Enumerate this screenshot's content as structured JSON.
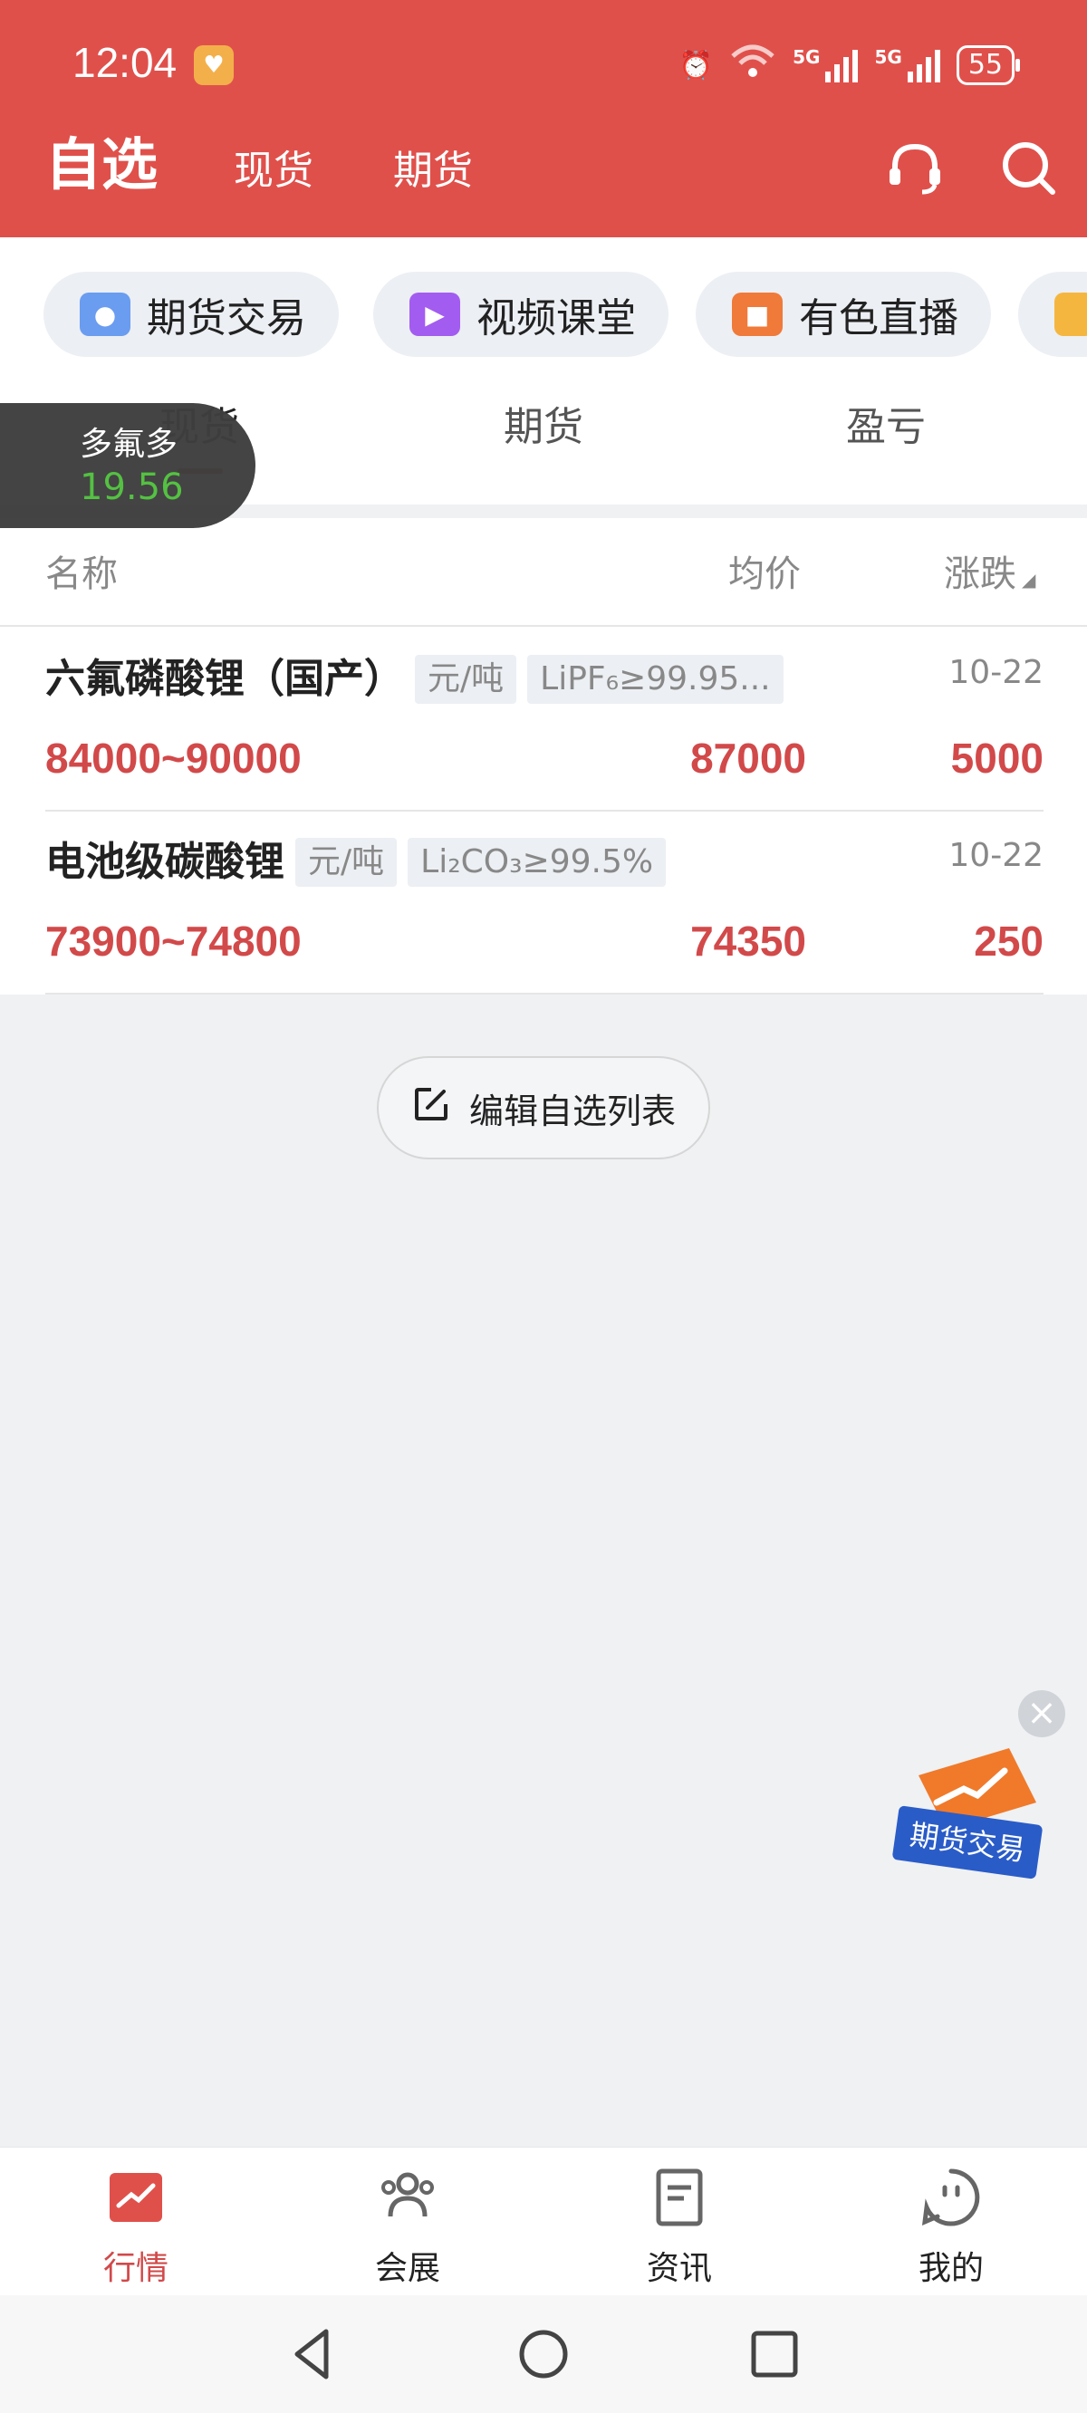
{
  "status_bar": {
    "time": "12:04",
    "network_1": "5G",
    "network_2": "5G",
    "battery": "55"
  },
  "header": {
    "title": "自选",
    "tabs": [
      "现货",
      "期货"
    ],
    "icons": [
      "headset-icon",
      "search-icon"
    ],
    "bg_color": "#e0504b"
  },
  "quick_chips": [
    {
      "label": "期货交易",
      "icon": "trader-icon"
    },
    {
      "label": "视频课堂",
      "icon": "video-icon"
    },
    {
      "label": "有色直播",
      "icon": "live-camera-icon"
    }
  ],
  "sub_tabs": {
    "items": [
      "现货",
      "期货",
      "盈亏"
    ],
    "active": "现货"
  },
  "floating_ticker": {
    "name": "多氟多",
    "value": "19.56"
  },
  "table": {
    "columns": {
      "name": "名称",
      "avg": "均价",
      "change": "涨跌"
    },
    "rows": [
      {
        "name": "六氟磷酸锂（国产）",
        "unit": "元/吨",
        "spec": "LiPF₆≥99.95...",
        "date": "10-22",
        "range": "84000~90000",
        "avg": "87000",
        "change": "5000"
      },
      {
        "name": "电池级碳酸锂",
        "unit": "元/吨",
        "spec": "Li₂CO₃≥99.5%",
        "date": "10-22",
        "range": "73900~74800",
        "avg": "74350",
        "change": "250"
      }
    ],
    "up_color": "#d2494a"
  },
  "edit_button": {
    "label": "编辑自选列表"
  },
  "promo": {
    "label": "期货交易"
  },
  "bottom_nav": [
    {
      "label": "行情",
      "icon": "market-icon",
      "active": true
    },
    {
      "label": "会展",
      "icon": "people-icon",
      "active": false
    },
    {
      "label": "资讯",
      "icon": "news-icon",
      "active": false
    },
    {
      "label": "我的",
      "icon": "profile-icon",
      "active": false
    }
  ]
}
